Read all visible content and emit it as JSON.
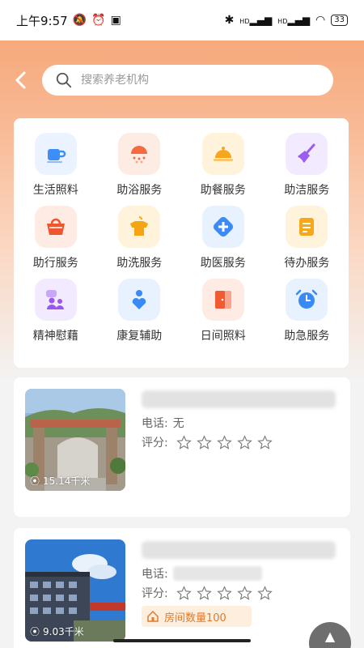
{
  "status_bar": {
    "time": "上午9:57",
    "battery": "33",
    "network_1": "HD",
    "network_2": "HD"
  },
  "header": {
    "back_icon": "chevron-left-icon",
    "search_placeholder": "搜索养老机构",
    "search_icon": "search-icon"
  },
  "services": [
    {
      "label": "生活照料",
      "icon": "cup-icon",
      "color": "#3e8ef7",
      "bg": "#eaf3ff"
    },
    {
      "label": "助浴服务",
      "icon": "shower-icon",
      "color": "#f36b3f",
      "bg": "#fdece4"
    },
    {
      "label": "助餐服务",
      "icon": "dish-cover-icon",
      "color": "#f7a41e",
      "bg": "#fff3dc"
    },
    {
      "label": "助洁服务",
      "icon": "broom-icon",
      "color": "#9b5cf0",
      "bg": "#f2eafe"
    },
    {
      "label": "助行服务",
      "icon": "basket-icon",
      "color": "#f0562e",
      "bg": "#fdebe4"
    },
    {
      "label": "助洗服务",
      "icon": "shirt-icon",
      "color": "#f5a514",
      "bg": "#fff3dc"
    },
    {
      "label": "助医服务",
      "icon": "medical-plus-icon",
      "color": "#3b8af5",
      "bg": "#e8f1fe"
    },
    {
      "label": "待办服务",
      "icon": "document-icon",
      "color": "#f6a81c",
      "bg": "#fff3dc"
    },
    {
      "label": "精神慰藉",
      "icon": "chat-people-icon",
      "color": "#9a55ee",
      "bg": "#f2eafe"
    },
    {
      "label": "康复辅助",
      "icon": "person-heart-icon",
      "color": "#3a8af6",
      "bg": "#e8f1fe"
    },
    {
      "label": "日间照料",
      "icon": "door-icon",
      "color": "#f25a32",
      "bg": "#fdebe4"
    },
    {
      "label": "助急服务",
      "icon": "alarm-clock-icon",
      "color": "#3a8af6",
      "bg": "#e8f1fe"
    }
  ],
  "institutions": [
    {
      "distance": "15.14千米",
      "phone_label": "电话:",
      "phone": "无",
      "rating_label": "评分:",
      "rating": 0,
      "stars_total": 5
    },
    {
      "distance": "9.03千米",
      "phone_label": "电话:",
      "rating_label": "评分:",
      "rating": 0,
      "stars_total": 5,
      "room_badge": "房间数量100"
    }
  ]
}
